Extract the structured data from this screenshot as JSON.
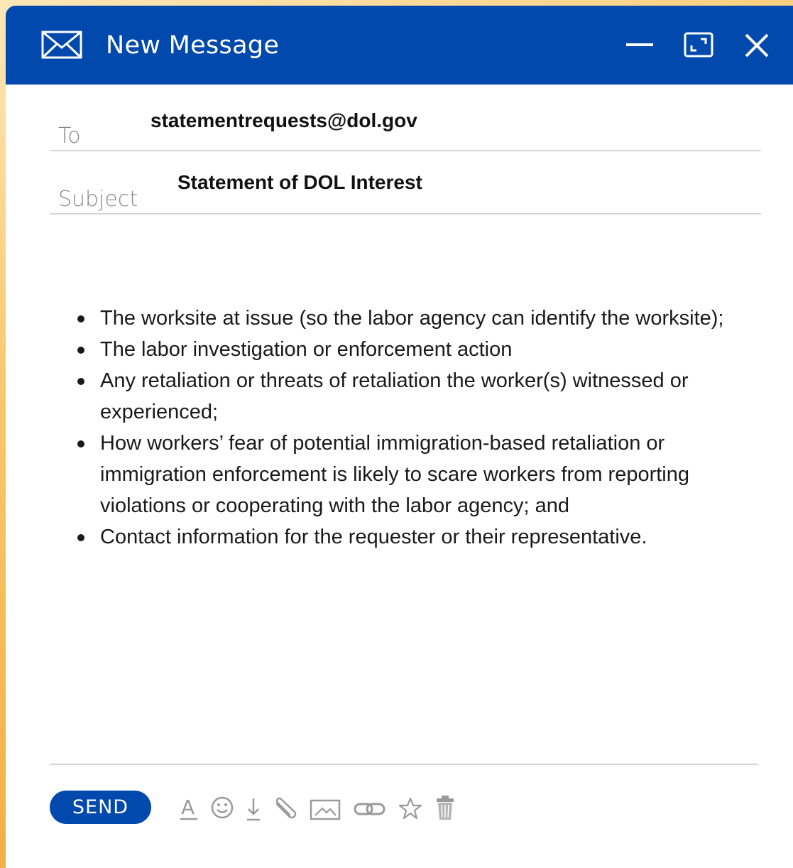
{
  "window": {
    "title": "New Message",
    "icon": "envelope-icon"
  },
  "title_controls": [
    "minimize-icon",
    "maximize-icon",
    "close-icon"
  ],
  "fields": {
    "to": {
      "label": "To",
      "value": "statementrequests@dol.gov"
    },
    "subject": {
      "label": "Subject",
      "value": "Statement of DOL Interest"
    }
  },
  "body": {
    "bullets": [
      "The worksite at issue (so the labor agency can identify the worksite);",
      " The labor investigation or enforcement action",
      " Any retaliation or threats of retaliation the worker(s) witnessed or experienced;",
      " How workers’ fear of potential immigration-based retaliation or immigration enforcement is likely to scare workers from reporting violations or cooperating with the labor agency; and",
      "Contact information for the requester or their representative."
    ]
  },
  "footer": {
    "send_label": "SEND",
    "tools": [
      "text-format-icon",
      "emoji-icon",
      "download-icon",
      "attachment-icon",
      "image-icon",
      "link-icon",
      "star-icon",
      "trash-icon"
    ]
  },
  "colors": {
    "brand_blue": "#0249ad",
    "background": "#f3b34a"
  }
}
